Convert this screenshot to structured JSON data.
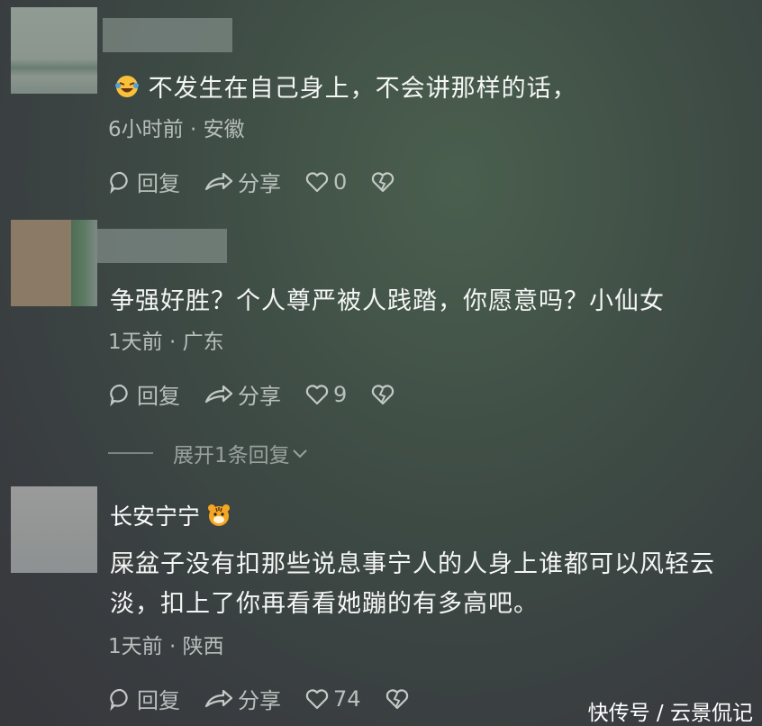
{
  "comments": [
    {
      "emoji_icon": "laughing-crying-emoji",
      "text": "不发生在自己身上，不会讲那样的话，",
      "time": "6小时前",
      "location": "安徽",
      "reply_label": "回复",
      "share_label": "分享",
      "likes": "0"
    },
    {
      "text": "争强好胜？个人尊严被人践踏，你愿意吗？小仙女",
      "time": "1天前",
      "location": "广东",
      "reply_label": "回复",
      "share_label": "分享",
      "likes": "9",
      "expand_label": "展开1条回复"
    },
    {
      "username": "长安宁宁",
      "username_icon": "tiger-emoji",
      "text_line1": "屎盆子没有扣那些说息事宁人的人身上谁都可以风轻云",
      "text_line2": "淡，扣上了你再看看她蹦的有多高吧。",
      "time": "1天前",
      "location": "陕西",
      "reply_label": "回复",
      "share_label": "分享",
      "likes": "74"
    }
  ],
  "meta_separator": "·",
  "watermark": "快传号 / 云景侃记"
}
